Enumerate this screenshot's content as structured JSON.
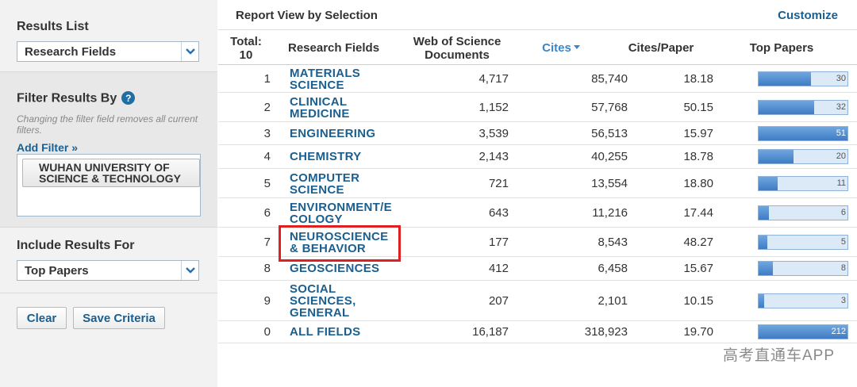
{
  "sidebar": {
    "results_list": {
      "heading": "Results List",
      "selected": "Research Fields"
    },
    "filter": {
      "heading": "Filter Results By",
      "help": "?",
      "note": "Changing the filter field removes all current filters.",
      "add_filter": "Add Filter »",
      "chip": "WUHAN UNIVERSITY OF SCIENCE & TECHNOLOGY"
    },
    "include": {
      "heading": "Include Results For",
      "selected": "Top Papers"
    },
    "buttons": {
      "clear": "Clear",
      "save": "Save Criteria"
    }
  },
  "main": {
    "title": "Report View by Selection",
    "customize": "Customize",
    "headers": {
      "total": "Total: 10",
      "field": "Research Fields",
      "docs": "Web of Science Documents",
      "cites": "Cites",
      "cpp": "Cites/Paper",
      "top": "Top Papers"
    },
    "rows": [
      {
        "rank": "1",
        "field": "MATERIALS SCIENCE",
        "docs": "4,717",
        "cites": "85,740",
        "cpp": "18.18",
        "top": "30",
        "top_value": 30
      },
      {
        "rank": "2",
        "field": "CLINICAL MEDICINE",
        "docs": "1,152",
        "cites": "57,768",
        "cpp": "50.15",
        "top": "32",
        "top_value": 32
      },
      {
        "rank": "3",
        "field": "ENGINEERING",
        "docs": "3,539",
        "cites": "56,513",
        "cpp": "15.97",
        "top": "51",
        "top_value": 51
      },
      {
        "rank": "4",
        "field": "CHEMISTRY",
        "docs": "2,143",
        "cites": "40,255",
        "cpp": "18.78",
        "top": "20",
        "top_value": 20
      },
      {
        "rank": "5",
        "field": "COMPUTER SCIENCE",
        "docs": "721",
        "cites": "13,554",
        "cpp": "18.80",
        "top": "11",
        "top_value": 11
      },
      {
        "rank": "6",
        "field": "ENVIRONMENT/ECOLOGY",
        "docs": "643",
        "cites": "11,216",
        "cpp": "17.44",
        "top": "6",
        "top_value": 6
      },
      {
        "rank": "7",
        "field": "NEUROSCIENCE & BEHAVIOR",
        "docs": "177",
        "cites": "8,543",
        "cpp": "48.27",
        "top": "5",
        "top_value": 5
      },
      {
        "rank": "8",
        "field": "GEOSCIENCES",
        "docs": "412",
        "cites": "6,458",
        "cpp": "15.67",
        "top": "8",
        "top_value": 8
      },
      {
        "rank": "9",
        "field": "SOCIAL SCIENCES, GENERAL",
        "docs": "207",
        "cites": "2,101",
        "cpp": "10.15",
        "top": "3",
        "top_value": 3
      },
      {
        "rank": "0",
        "field": "ALL FIELDS",
        "docs": "16,187",
        "cites": "318,923",
        "cpp": "19.70",
        "top": "212",
        "top_value": 212
      }
    ]
  },
  "watermark": "高考直通车APP",
  "colors": {
    "link": "#1a5f8f",
    "bar": "#3e7cc4",
    "highlight": "#e02020"
  }
}
